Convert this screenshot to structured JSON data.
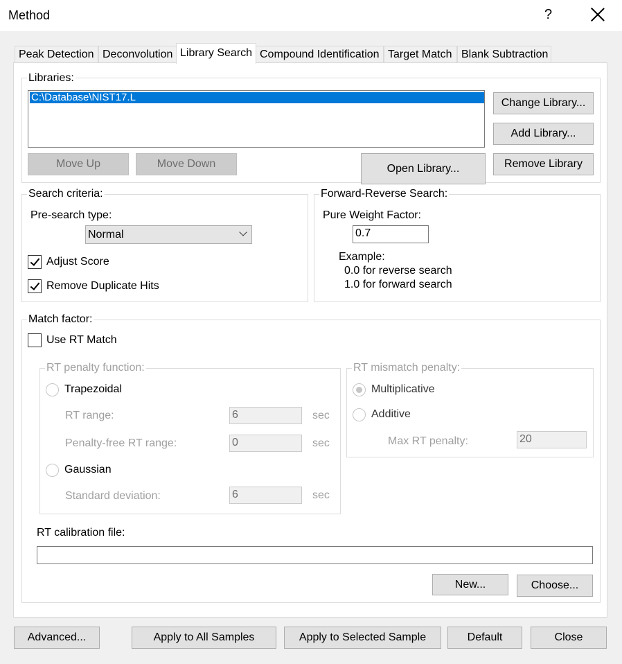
{
  "window": {
    "title": "Method",
    "help_glyph": "?"
  },
  "tabs": [
    {
      "label": "Peak Detection"
    },
    {
      "label": "Deconvolution"
    },
    {
      "label": "Library Search"
    },
    {
      "label": "Compound Identification"
    },
    {
      "label": "Target Match"
    },
    {
      "label": "Blank Subtraction"
    }
  ],
  "active_tab": "Library Search",
  "libraries": {
    "label": "Libraries:",
    "items": [
      "C:\\Database\\NIST17.L"
    ],
    "selected_index": 0,
    "change_library": "Change Library...",
    "add_library": "Add Library...",
    "remove_library": "Remove Library",
    "open_library": "Open Library...",
    "move_up": "Move Up",
    "move_down": "Move Down"
  },
  "search_criteria": {
    "label": "Search criteria:",
    "presearch_label": "Pre-search type:",
    "presearch_value": "Normal",
    "adjust_score": {
      "label": "Adjust Score",
      "checked": true
    },
    "remove_duplicates": {
      "label": "Remove Duplicate Hits",
      "checked": true
    }
  },
  "forward_reverse": {
    "label": "Forward-Reverse Search:",
    "weight_label": "Pure Weight Factor:",
    "weight_value": "0.7",
    "example_label": "Example:",
    "example_line1": "0.0 for reverse search",
    "example_line2": "1.0 for forward search"
  },
  "match_factor": {
    "label": "Match factor:",
    "use_rt_match": {
      "label": "Use RT Match",
      "checked": false
    },
    "rt_penalty_function": {
      "label": "RT penalty function:",
      "trapezoidal": "Trapezoidal",
      "rt_range_label": "RT range:",
      "rt_range_value": "6",
      "penalty_free_label": "Penalty-free RT range:",
      "penalty_free_value": "0",
      "gaussian": "Gaussian",
      "std_dev_label": "Standard deviation:",
      "std_dev_value": "6",
      "unit": "sec"
    },
    "rt_mismatch_penalty": {
      "label": "RT mismatch penalty:",
      "multiplicative": "Multiplicative",
      "additive": "Additive",
      "max_penalty_label": "Max RT penalty:",
      "max_penalty_value": "20"
    },
    "calibration_label": "RT calibration file:",
    "calibration_value": "",
    "new_button": "New...",
    "choose_button": "Choose..."
  },
  "footer": {
    "advanced": "Advanced...",
    "apply_all": "Apply to All Samples",
    "apply_selected": "Apply to Selected Sample",
    "default": "Default",
    "close": "Close"
  }
}
